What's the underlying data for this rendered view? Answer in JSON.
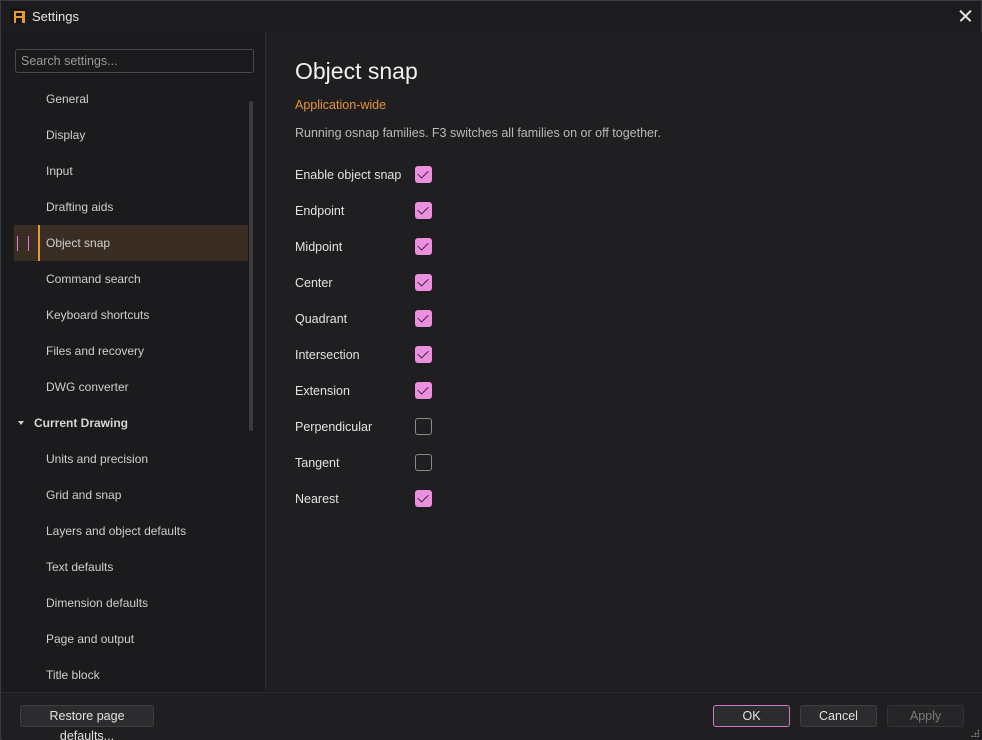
{
  "window": {
    "title": "Settings"
  },
  "search": {
    "placeholder": "Search settings..."
  },
  "sidebar": {
    "items": [
      {
        "label": "General"
      },
      {
        "label": "Display"
      },
      {
        "label": "Input"
      },
      {
        "label": "Drafting aids"
      },
      {
        "label": "Object snap",
        "selected": true
      },
      {
        "label": "Command search"
      },
      {
        "label": "Keyboard shortcuts"
      },
      {
        "label": "Files and recovery"
      },
      {
        "label": "DWG converter"
      }
    ],
    "group": {
      "label": "Current Drawing",
      "expanded": true,
      "items": [
        {
          "label": "Units and precision"
        },
        {
          "label": "Grid and snap"
        },
        {
          "label": "Layers and object defaults"
        },
        {
          "label": "Text defaults"
        },
        {
          "label": "Dimension defaults"
        },
        {
          "label": "Page and output"
        },
        {
          "label": "Title block"
        }
      ]
    }
  },
  "main": {
    "title": "Object snap",
    "scope": "Application-wide",
    "description": "Running osnap families. F3 switches all families on or off together.",
    "options": [
      {
        "label": "Enable object snap",
        "checked": true
      },
      {
        "label": "Endpoint",
        "checked": true
      },
      {
        "label": "Midpoint",
        "checked": true
      },
      {
        "label": "Center",
        "checked": true
      },
      {
        "label": "Quadrant",
        "checked": true
      },
      {
        "label": "Intersection",
        "checked": true
      },
      {
        "label": "Extension",
        "checked": true
      },
      {
        "label": "Perpendicular",
        "checked": false
      },
      {
        "label": "Tangent",
        "checked": false
      },
      {
        "label": "Nearest",
        "checked": true
      }
    ]
  },
  "footer": {
    "restore_label": "Restore page defaults...",
    "ok_label": "OK",
    "cancel_label": "Cancel",
    "apply_label": "Apply",
    "apply_enabled": false
  },
  "colors": {
    "accent_orange": "#e89830",
    "accent_pink": "#ec8fe0",
    "background": "#1f1f21",
    "sidebar_selected": "#3a2e24"
  }
}
